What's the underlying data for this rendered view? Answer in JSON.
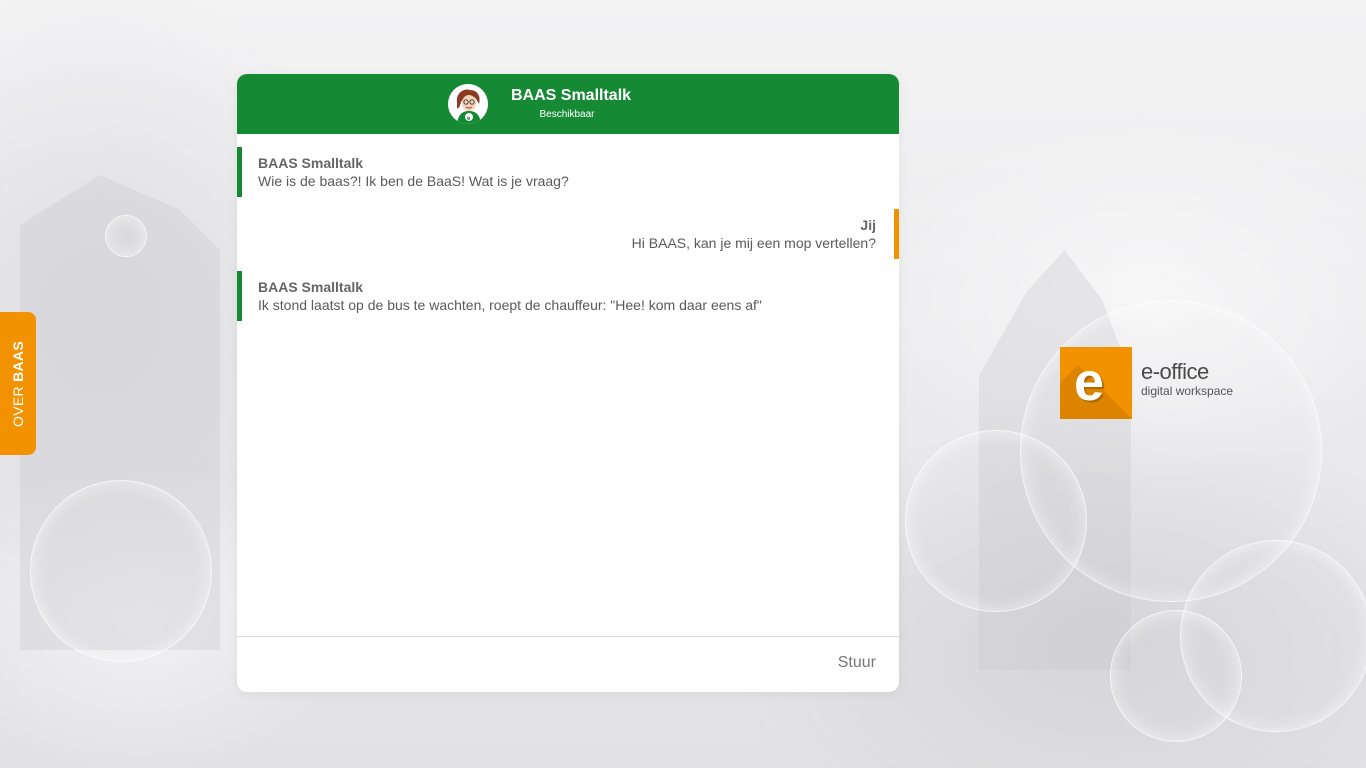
{
  "chat": {
    "title": "BAAS Smalltalk",
    "status": "Beschikbaar",
    "avatar_icon": "woman-avatar-icon",
    "messages": [
      {
        "from": "bot",
        "sender": "BAAS Smalltalk",
        "text": "Wie is de baas?! Ik ben de BaaS! Wat is je vraag?"
      },
      {
        "from": "user",
        "sender": "Jij",
        "text": "Hi BAAS, kan je mij een mop vertellen?"
      },
      {
        "from": "bot",
        "sender": "BAAS Smalltalk",
        "text": "Ik stond laatst op de bus te wachten, roept de chauffeur: \"Hee! kom daar eens af\""
      }
    ],
    "input": {
      "value": "",
      "placeholder": ""
    },
    "send_label": "Stuur"
  },
  "side_tab": {
    "prefix": "OVER",
    "bold": "BAAS"
  },
  "logo": {
    "letter": "e",
    "name": "e-office",
    "tagline": "digital workspace"
  },
  "colors": {
    "header_green": "#168934",
    "accent_orange": "#f39200",
    "text_gray": "#555555"
  }
}
